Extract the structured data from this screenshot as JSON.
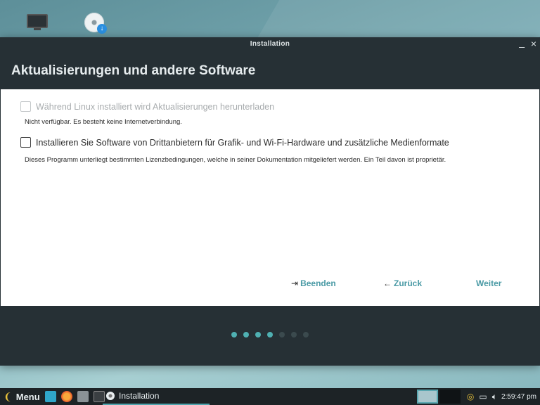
{
  "window": {
    "title": "Installation",
    "heading": "Aktualisierungen und andere Software"
  },
  "options": {
    "download_updates": {
      "label": "Während Linux installiert wird Aktualisierungen herunterladen",
      "note": "Nicht verfügbar. Es besteht keine Internetverbindung.",
      "checked": false,
      "enabled": false
    },
    "third_party": {
      "label": "Installieren Sie Software von Drittanbietern für Grafik- und Wi-Fi-Hardware und zusätzliche Medienformate",
      "note": "Dieses Programm unterliegt bestimmten Lizenzbedingungen, welche in seiner Dokumentation mitgeliefert werden. Ein Teil davon ist proprietär.",
      "checked": false,
      "enabled": true
    }
  },
  "buttons": {
    "quit": "Beenden",
    "back": "Zurück",
    "next": "Weiter"
  },
  "progress": {
    "total_steps": 7,
    "completed_steps": 4,
    "active_color": "#4fb0b2",
    "inactive_color": "#3b4a4e"
  },
  "taskbar": {
    "menu_label": "Menu",
    "task_label": "Installation",
    "clock": "2:59:47 pm"
  },
  "colors": {
    "accent": "#4a9aa5",
    "window_bg": "#263035",
    "taskbar_bg": "#1d2326"
  }
}
